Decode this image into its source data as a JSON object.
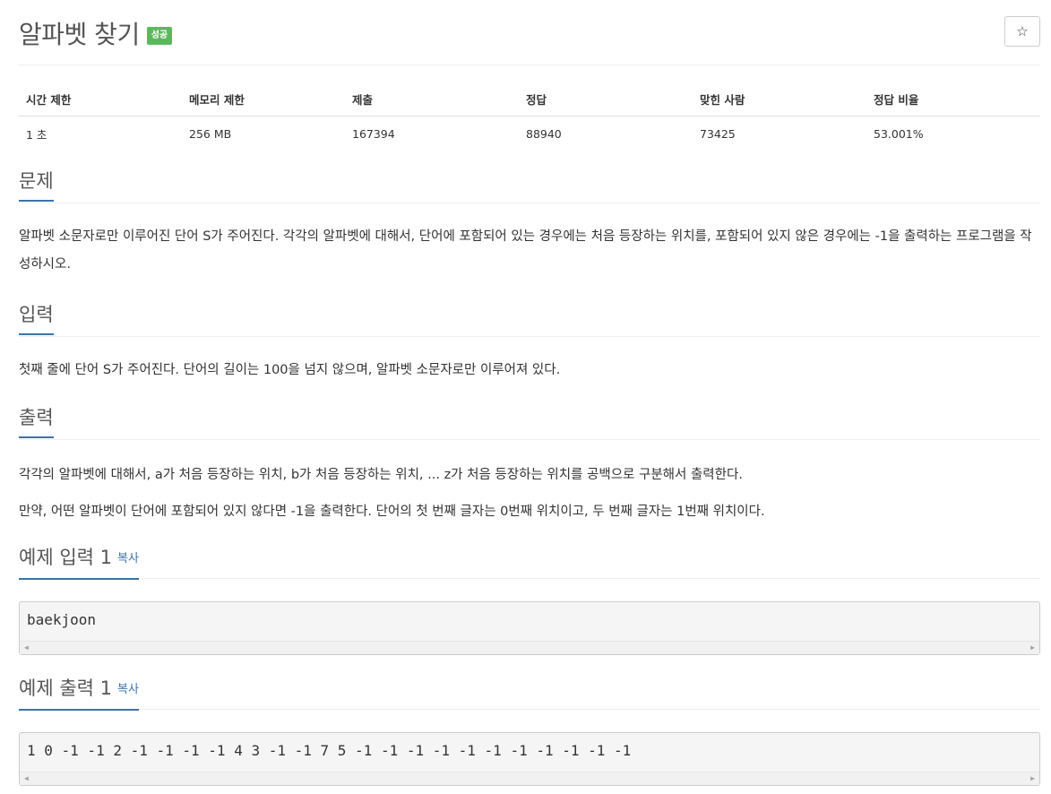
{
  "problem": {
    "title": "알파벳 찾기",
    "status": "성공",
    "star_icon": "☆"
  },
  "info_table": {
    "headers": [
      "시간 제한",
      "메모리 제한",
      "제출",
      "정답",
      "맞힌 사람",
      "정답 비율"
    ],
    "values": [
      "1 초",
      "256 MB",
      "167394",
      "88940",
      "73425",
      "53.001%"
    ]
  },
  "sections": {
    "description": {
      "title": "문제",
      "text": "알파벳 소문자로만 이루어진 단어 S가 주어진다. 각각의 알파벳에 대해서, 단어에 포함되어 있는 경우에는 처음 등장하는 위치를, 포함되어 있지 않은 경우에는 -1을 출력하는 프로그램을 작성하시오."
    },
    "input": {
      "title": "입력",
      "text": "첫째 줄에 단어 S가 주어진다. 단어의 길이는 100을 넘지 않으며, 알파벳 소문자로만 이루어져 있다."
    },
    "output": {
      "title": "출력",
      "text1": "각각의 알파벳에 대해서, a가 처음 등장하는 위치, b가 처음 등장하는 위치, ... z가 처음 등장하는 위치를 공백으로 구분해서 출력한다.",
      "text2": "만약, 어떤 알파벳이 단어에 포함되어 있지 않다면 -1을 출력한다. 단어의 첫 번째 글자는 0번째 위치이고, 두 번째 글자는 1번째 위치이다."
    },
    "sample_input": {
      "title": "예제 입력 1",
      "copy": "복사",
      "content": "baekjoon"
    },
    "sample_output": {
      "title": "예제 출력 1",
      "copy": "복사",
      "content": "1 0 -1 -1 2 -1 -1 -1 -1 4 3 -1 -1 7 5 -1 -1 -1 -1 -1 -1 -1 -1 -1 -1 -1"
    }
  },
  "colors": {
    "accent": "#3c73a8",
    "success": "#5cb85c"
  }
}
